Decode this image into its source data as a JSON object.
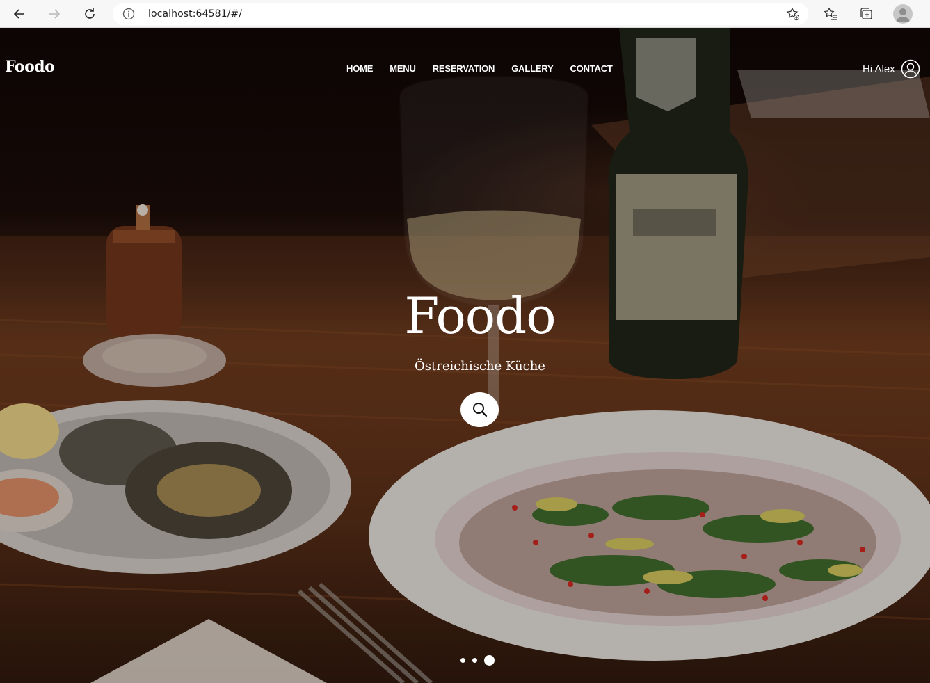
{
  "browser": {
    "url": "localhost:64581/#/"
  },
  "site": {
    "brand": "Foodo",
    "nav": [
      "HOME",
      "MENU",
      "RESERVATION",
      "GALLERY",
      "CONTACT"
    ],
    "greeting": "Hi Alex"
  },
  "hero": {
    "title": "Foodo",
    "subtitle": "Östreichische Küche",
    "slides_total": 3,
    "active_slide": 3
  },
  "icons": {
    "back": "arrow-left-icon",
    "forward": "arrow-right-icon",
    "reload": "reload-icon",
    "info": "info-icon",
    "add_favorite": "star-plus-icon",
    "favorites": "favorites-list-icon",
    "collections": "collections-icon",
    "profile": "profile-avatar-icon",
    "user": "user-circle-icon",
    "search": "search-icon"
  },
  "colors": {
    "chrome_bg": "#f7f7f7",
    "text_on_hero": "#ffffff"
  }
}
